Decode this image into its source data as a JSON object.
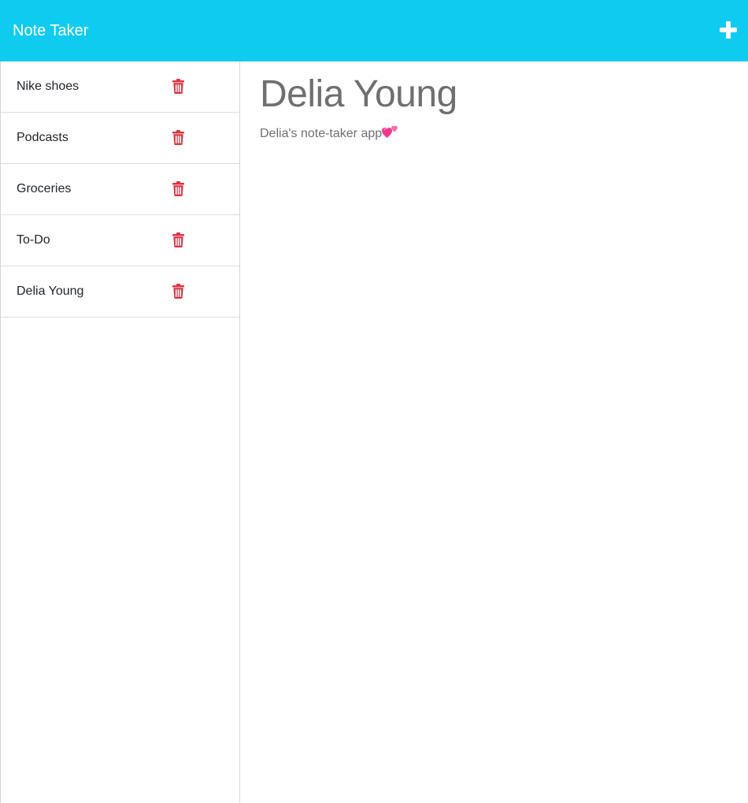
{
  "app": {
    "title": "Note Taker"
  },
  "colors": {
    "navbar": "#10cbf0",
    "trash": "#dc3545",
    "heading_text": "#6f6f6f"
  },
  "header": {
    "add_icon": "plus-icon"
  },
  "notes": [
    {
      "title": "Nike shoes",
      "icon": "trash-icon"
    },
    {
      "title": "Podcasts",
      "icon": "trash-icon"
    },
    {
      "title": "Groceries",
      "icon": "trash-icon"
    },
    {
      "title": "To-Do",
      "icon": "trash-icon"
    },
    {
      "title": "Delia Young",
      "icon": "trash-icon"
    }
  ],
  "active_note": {
    "title": "Delia Young",
    "text": "Delia's note-taker app",
    "emoji_icon": "two-hearts-icon"
  }
}
